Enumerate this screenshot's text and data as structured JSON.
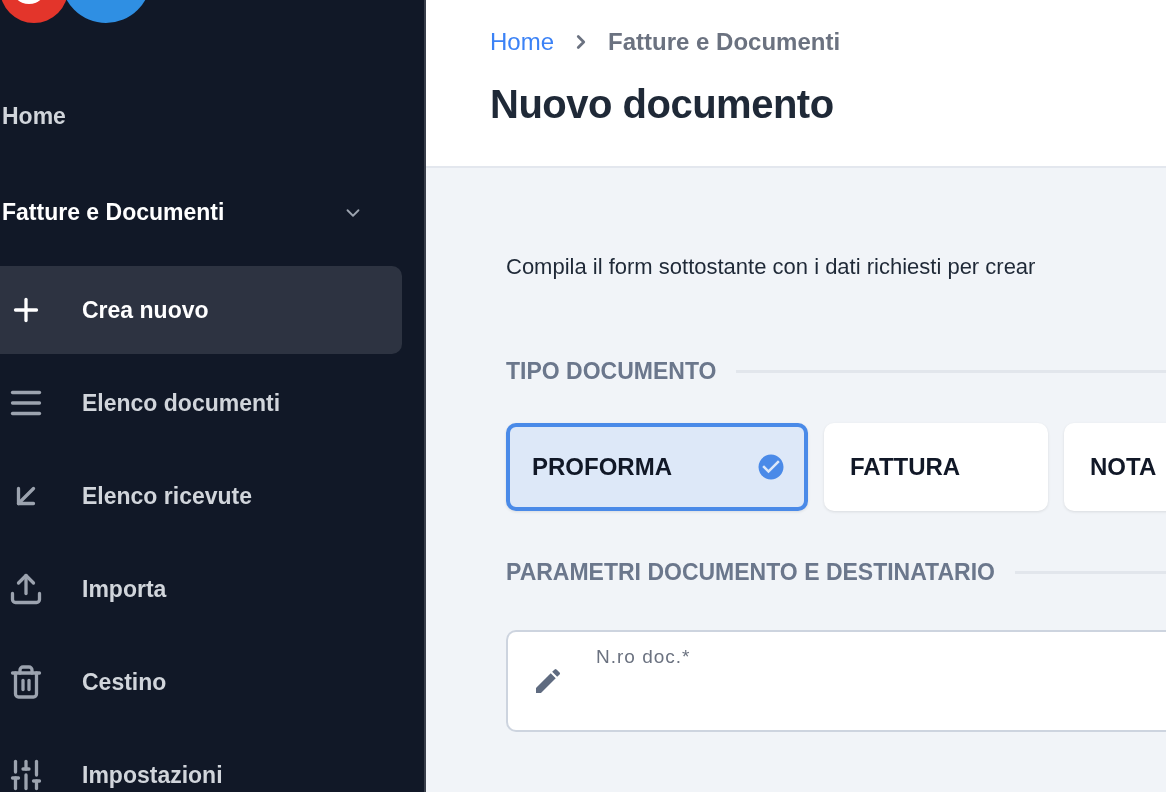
{
  "sidebar": {
    "home": {
      "label": "Home"
    },
    "group": {
      "label": "Fatture e Documenti",
      "expanded": true,
      "children": [
        {
          "label": "Crea nuovo",
          "selected": true
        },
        {
          "label": "Elenco documenti",
          "selected": false
        },
        {
          "label": "Elenco ricevute",
          "selected": false
        },
        {
          "label": "Importa",
          "selected": false
        },
        {
          "label": "Cestino",
          "selected": false
        },
        {
          "label": "Impostazioni",
          "selected": false
        }
      ]
    }
  },
  "header": {
    "breadcrumb": [
      "Home",
      "Fatture e Documenti"
    ],
    "title": "Nuovo documento"
  },
  "intro": "Compila il form sottostante con i dati richiesti per crear",
  "sections": [
    {
      "title": "TIPO DOCUMENTO"
    },
    {
      "title": "PARAMETRI DOCUMENTO E DESTINATARIO"
    }
  ],
  "doc_types": [
    {
      "label": "PROFORMA",
      "selected": true
    },
    {
      "label": "FATTURA",
      "selected": false
    },
    {
      "label": "NOTA",
      "selected": false
    }
  ],
  "doc_number": {
    "label": "N.ro doc.*"
  }
}
